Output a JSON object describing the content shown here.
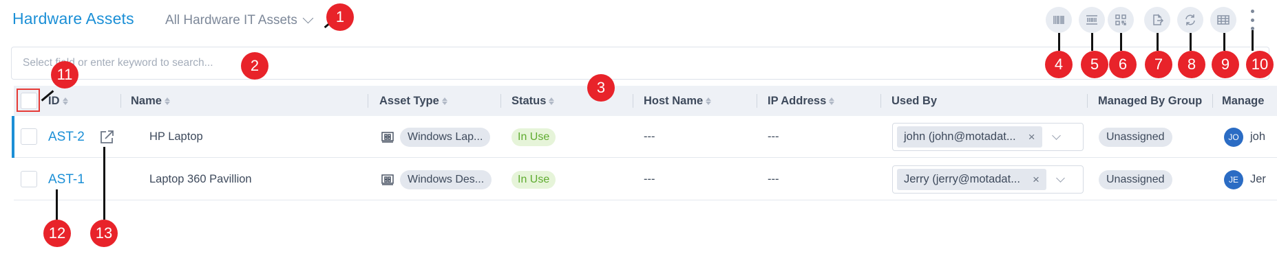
{
  "header": {
    "title": "Hardware Assets",
    "view": "All Hardware IT Assets"
  },
  "toolbar": [
    {
      "name": "barcode-button",
      "icon": "barcode-icon"
    },
    {
      "name": "print-barcode-button",
      "icon": "barcode-list-icon"
    },
    {
      "name": "qr-code-button",
      "icon": "qr-code-icon"
    },
    {
      "name": "export-button",
      "icon": "export-icon"
    },
    {
      "name": "refresh-button",
      "icon": "refresh-icon"
    },
    {
      "name": "column-settings-button",
      "icon": "table-grid-icon"
    },
    {
      "name": "more-options-button",
      "icon": "vertical-dots-icon"
    }
  ],
  "search": {
    "placeholder": "Select field or enter keyword to search..."
  },
  "table": {
    "columns": [
      "ID",
      "Name",
      "Asset Type",
      "Status",
      "Host Name",
      "IP Address",
      "Used By",
      "Managed By Group",
      "Manage"
    ],
    "rows": [
      {
        "id": "AST-2",
        "name": "HP Laptop",
        "asset_type": "Windows Lap...",
        "status": "In Use",
        "host_name": "---",
        "ip_address": "---",
        "used_by": "john (john@motadat...",
        "managed_by_group": "Unassigned",
        "manager_initials": "JO",
        "manager_name": "joh"
      },
      {
        "id": "AST-1",
        "name": "Laptop 360 Pavillion",
        "asset_type": "Windows Des...",
        "status": "In Use",
        "host_name": "---",
        "ip_address": "---",
        "used_by": "Jerry (jerry@motadat...",
        "managed_by_group": "Unassigned",
        "manager_initials": "JE",
        "manager_name": "Jer"
      }
    ]
  },
  "callouts": [
    "1",
    "2",
    "3",
    "4",
    "5",
    "6",
    "7",
    "8",
    "9",
    "10",
    "11",
    "12",
    "13"
  ],
  "colors": {
    "accent": "#1b8fd6",
    "callout": "#e8232a",
    "status_in_use_bg": "#e6f4d9",
    "status_in_use_text": "#5eab2f",
    "avatar": "#2b6cc4"
  }
}
